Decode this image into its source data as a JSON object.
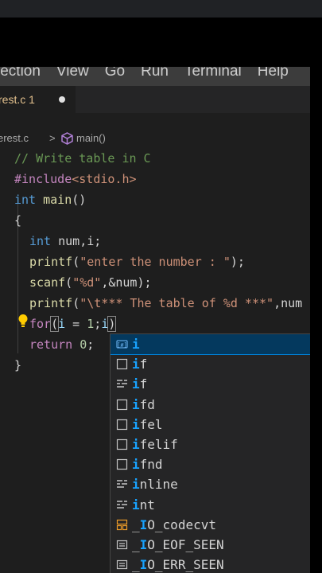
{
  "menubar": {
    "items": [
      "lection",
      "View",
      "Go",
      "Run",
      "Terminal",
      "Help"
    ]
  },
  "tab": {
    "name": "rest.c 1"
  },
  "breadcrumbs": {
    "file": "erest.c",
    "separator": ">",
    "symbol": "main()"
  },
  "code": {
    "l1": "// Write table in C",
    "l2_kw": "#include",
    "l2_hdr": "<stdio.h>",
    "l3_kw": "int",
    "l3_fn": "main",
    "l3_rest": "()",
    "l4": "{",
    "l5_kw": "int",
    "l5_rest": "num,i;",
    "l6_fn": "printf",
    "l6_open": "(",
    "l6_str": "\"enter the number : \"",
    "l6_close": ");",
    "l7_fn": "scanf",
    "l7_open": "(",
    "l7_str": "\"%d\"",
    "l7_rest": ",&num);",
    "l8_fn": "printf",
    "l8_open": "(",
    "l8_str": "\"\\t*** The table of %d ***\"",
    "l8_rest": ",num",
    "l9_kw": "for",
    "l9_open": "(",
    "l9_var": "i",
    "l9_eq": " = ",
    "l9_num": "1",
    "l9_semi": ";",
    "l9_var2": "i",
    "l9_close": ")",
    "l10_kw": "return",
    "l10_num": "0",
    "l10_semi": ";",
    "l11": "}"
  },
  "suggestions": [
    {
      "match": "i",
      "rest": "",
      "kind": "variable"
    },
    {
      "match": "i",
      "rest": "f",
      "kind": "snippet"
    },
    {
      "match": "i",
      "rest": "f",
      "kind": "keyword"
    },
    {
      "match": "i",
      "rest": "fd",
      "kind": "snippet"
    },
    {
      "match": "i",
      "rest": "fel",
      "kind": "snippet"
    },
    {
      "match": "i",
      "rest": "felif",
      "kind": "snippet"
    },
    {
      "match": "i",
      "rest": "fnd",
      "kind": "snippet"
    },
    {
      "pre": "",
      "match": "i",
      "rest": "nline",
      "kind": "keyword"
    },
    {
      "pre": "",
      "match": "i",
      "rest": "nt",
      "kind": "keyword"
    },
    {
      "pre": "_",
      "match": "I",
      "rest": "O_codecvt",
      "kind": "struct"
    },
    {
      "pre": "_",
      "match": "I",
      "rest": "O_EOF_SEEN",
      "kind": "constant"
    },
    {
      "pre": "_",
      "match": "I",
      "rest": "O_ERR_SEEN",
      "kind": "constant"
    }
  ],
  "colors": {
    "editor_bg": "#1e1e1e",
    "accent": "#007fd4",
    "match": "#18a3ff",
    "modified_tab": "#e2c08d"
  }
}
